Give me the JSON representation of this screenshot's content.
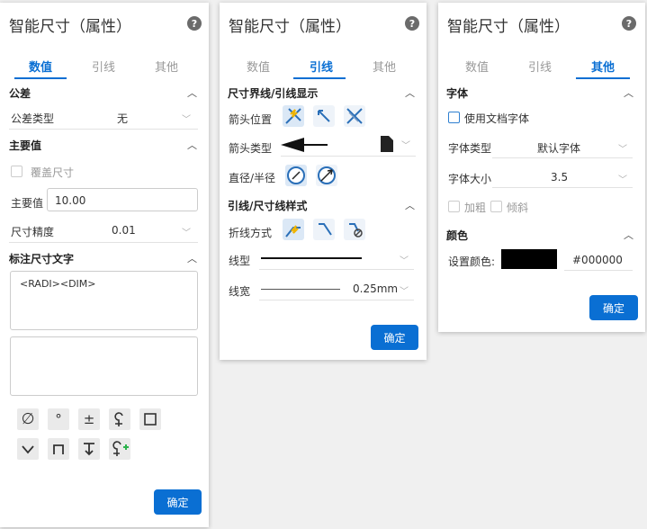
{
  "title": "智能尺寸（属性）",
  "help": "?",
  "tabs": [
    "数值",
    "引线",
    "其他"
  ],
  "confirm": "确定",
  "p1": {
    "tolerance_section": "公差",
    "tolerance_type_label": "公差类型",
    "tolerance_type_value": "无",
    "main_section": "主要值",
    "override_label": "覆盖尺寸",
    "main_value_label": "主要值",
    "main_value": "10.00",
    "precision_label": "尺寸精度",
    "precision_value": "0.01",
    "text_section": "标注尺寸文字",
    "text_value": "<RADI><DIM>"
  },
  "p2": {
    "display_section": "尺寸界线/引线显示",
    "arrow_pos_label": "箭头位置",
    "arrow_type_label": "箭头类型",
    "diam_label": "直径/半径",
    "style_section": "引线/尺寸线样式",
    "fold_label": "折线方式",
    "linetype_label": "线型",
    "linewidth_label": "线宽",
    "linewidth_value": "0.25mm"
  },
  "p3": {
    "font_section": "字体",
    "use_doc_font": "使用文档字体",
    "font_type_label": "字体类型",
    "font_type_value": "默认字体",
    "font_size_label": "字体大小",
    "font_size_value": "3.5",
    "bold_label": "加粗",
    "italic_label": "倾斜",
    "color_section": "颜色",
    "set_color_label": "设置颜色:",
    "color_hex": "#000000"
  },
  "colors": {
    "accent": "#0a6fd3",
    "swatch": "#000000"
  }
}
